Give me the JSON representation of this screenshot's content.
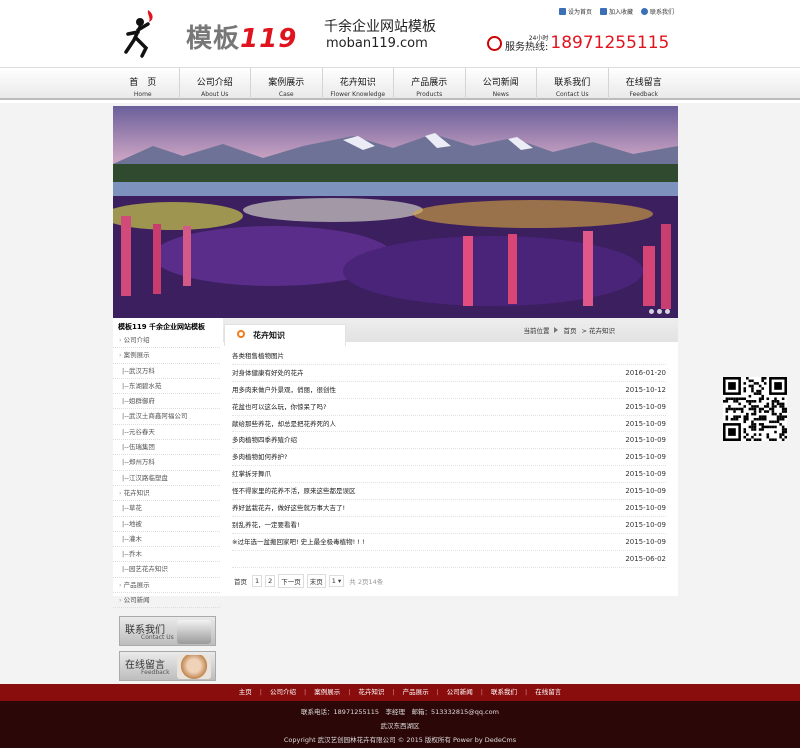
{
  "header": {
    "logo_main": "模板",
    "logo_num": "119",
    "logo_slogan": "千余企业网站模板",
    "logo_domain": "moban119.com",
    "toplinks": [
      "设为首页",
      "加入收藏",
      "联系我们"
    ],
    "hotline_small": "24小时",
    "hotline_label": "服务热线:",
    "hotline_number": "18971255115"
  },
  "nav": [
    {
      "cn": "首　页",
      "en": "Home"
    },
    {
      "cn": "公司介绍",
      "en": "About Us"
    },
    {
      "cn": "案例展示",
      "en": "Case"
    },
    {
      "cn": "花卉知识",
      "en": "Flower Knowledge"
    },
    {
      "cn": "产品展示",
      "en": "Products"
    },
    {
      "cn": "公司新闻",
      "en": "News"
    },
    {
      "cn": "联系我们",
      "en": "Contact Us"
    },
    {
      "cn": "在线留言",
      "en": "Feedback"
    }
  ],
  "sidebar": {
    "title": "模板119 千余企业网站模板",
    "items": [
      {
        "label": "公司介绍",
        "type": "cat"
      },
      {
        "label": "案例展示",
        "type": "cat"
      },
      {
        "label": "|--武汉万科",
        "type": "sub"
      },
      {
        "label": "|--东湖碧水苑",
        "type": "sub"
      },
      {
        "label": "|--姐群御府",
        "type": "sub"
      },
      {
        "label": "|--武汉土商鑫阿福公司",
        "type": "sub"
      },
      {
        "label": "|--元谷春天",
        "type": "sub"
      },
      {
        "label": "|--伍瑞集团",
        "type": "sub"
      },
      {
        "label": "|--郑州万科",
        "type": "sub"
      },
      {
        "label": "|--江汉路临塑盘",
        "type": "sub"
      },
      {
        "label": "花卉知识",
        "type": "cat"
      },
      {
        "label": "|--草花",
        "type": "sub"
      },
      {
        "label": "|--地被",
        "type": "sub"
      },
      {
        "label": "|--灌木",
        "type": "sub"
      },
      {
        "label": "|--乔木",
        "type": "sub"
      },
      {
        "label": "|--园艺花卉知识",
        "type": "sub"
      },
      {
        "label": "产品展示",
        "type": "cat"
      },
      {
        "label": "公司新闻",
        "type": "cat"
      }
    ],
    "contact_btn": {
      "cn": "联系我们",
      "en": "Contact Us"
    },
    "feedback_btn": {
      "cn": "在线留言",
      "en": "Feedback"
    }
  },
  "content": {
    "section_title": "花卉知识",
    "crumb": [
      "当前位置",
      "首页",
      "> 花卉知识"
    ],
    "articles": [
      {
        "title": "各类租售植物图片",
        "date": ""
      },
      {
        "title": "对身体健康有好处的花卉",
        "date": "2016-01-20"
      },
      {
        "title": "用多肉来做户外景观，俏丽，很创性",
        "date": "2015-10-12"
      },
      {
        "title": "花盆也可以这么玩，你惊呆了吗?",
        "date": "2015-10-09"
      },
      {
        "title": "献给那些养花，却总是把花养死的人",
        "date": "2015-10-09"
      },
      {
        "title": "多肉植物四季养殖介绍",
        "date": "2015-10-09"
      },
      {
        "title": "多肉植物如何养护?",
        "date": "2015-10-09"
      },
      {
        "title": "红掌拆牙舞爪",
        "date": "2015-10-09"
      },
      {
        "title": "怪不得家里的花养不活，原来这些都是误区",
        "date": "2015-10-09"
      },
      {
        "title": "养好盆栽花卉，做好这些就万事大吉了!",
        "date": "2015-10-09"
      },
      {
        "title": "别乱养花，一定要看看!",
        "date": "2015-10-09"
      },
      {
        "title": "※过年选一盆搬回家吧! 史上最全极毒植物! ! !",
        "date": "2015-10-09"
      },
      {
        "title": "",
        "date": "2015-06-02"
      }
    ],
    "pager": {
      "first": "首页",
      "p1": "1",
      "p2": "2",
      "next": "下一页",
      "last": "末页",
      "select": "1",
      "info": "共 2页14条"
    }
  },
  "footer": {
    "links": [
      "主页",
      "公司介绍",
      "案例展示",
      "花卉知识",
      "产品展示",
      "公司新闻",
      "联系我们",
      "在线留言"
    ],
    "contact": "联系电话：18971255115　李经理　邮箱：513332815@qq.com",
    "address": "武汉东西湖区",
    "copyright": "Copyright 武汉艺创园林花卉有限公司 © 2015 版权所有 Power by DedeCms"
  },
  "colors": {
    "accent_red": "#e0141e",
    "footer_red": "#8a0d0d",
    "footer_dark": "#2c0707",
    "orange_icon": "#f07c1e"
  }
}
